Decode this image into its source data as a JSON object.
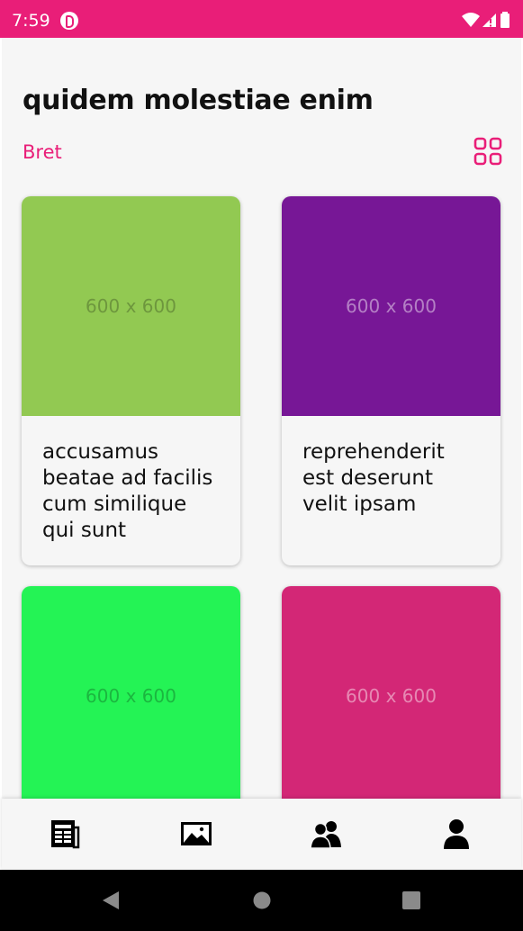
{
  "status_bar": {
    "time": "7:59",
    "background": "#e91e78",
    "icons": [
      "notification-app-icon",
      "wifi-icon",
      "signal-icon",
      "battery-icon"
    ]
  },
  "header": {
    "title": "quidem molestiae enim",
    "author": "Bret",
    "accent_color": "#e91e78",
    "view_toggle_icon": "grid-view-icon"
  },
  "cards": [
    {
      "image_text": "600 x 600",
      "color": "#92c952",
      "title": "accusamus beatae ad facilis cum similique qui sunt"
    },
    {
      "image_text": "600 x 600",
      "color": "#771796",
      "title": "reprehenderit est deserunt velit ipsam"
    },
    {
      "image_text": "600 x 600",
      "color": "#24f355",
      "title": ""
    },
    {
      "image_text": "600 x 600",
      "color": "#d32776",
      "title": ""
    }
  ],
  "bottom_nav": {
    "items": [
      "posts-icon",
      "photos-icon",
      "users-icon",
      "profile-icon"
    ]
  },
  "system_nav": {
    "buttons": [
      "back-icon",
      "home-icon",
      "recents-icon"
    ]
  }
}
